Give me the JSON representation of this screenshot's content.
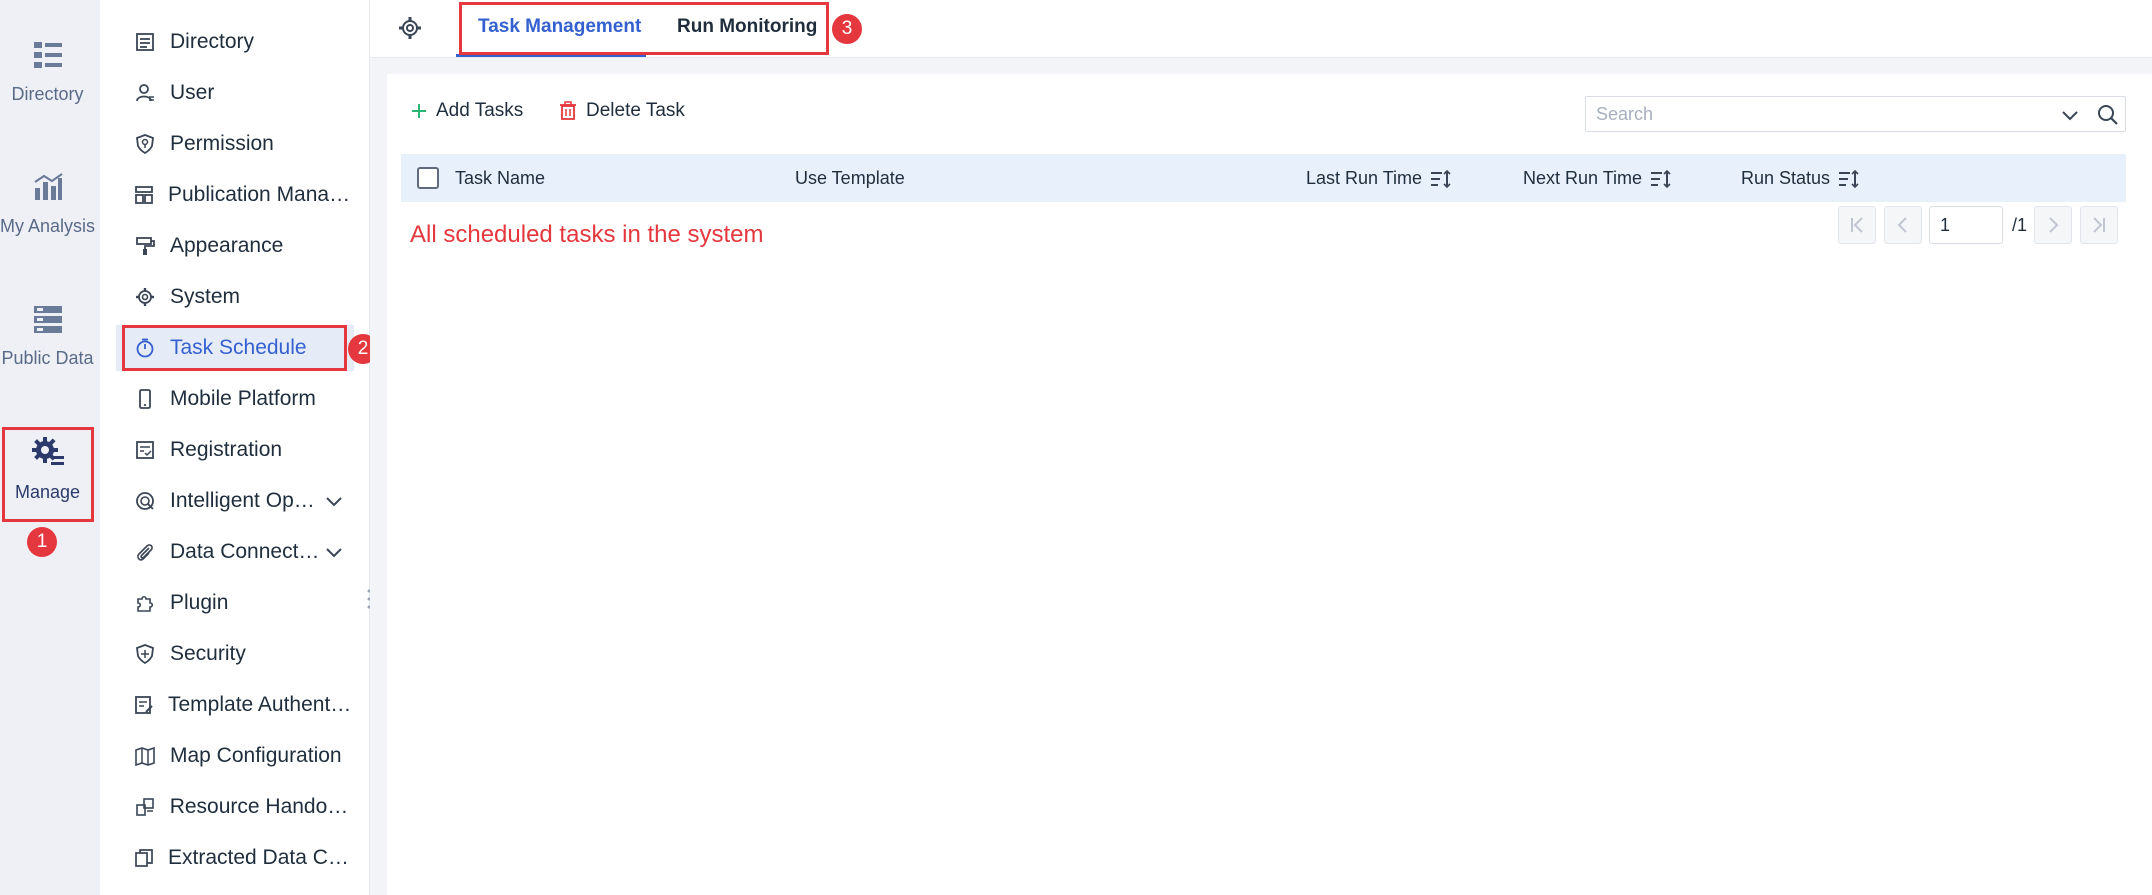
{
  "rail": {
    "items": [
      {
        "label": "Directory",
        "icon": "directory-list-icon"
      },
      {
        "label": "My Analysis",
        "icon": "analysis-chart-icon"
      },
      {
        "label": "Public Data",
        "icon": "public-data-icon"
      },
      {
        "label": "Manage",
        "icon": "manage-gear-icon"
      }
    ]
  },
  "menu": {
    "items": [
      {
        "label": "Directory",
        "icon": "directory-icon"
      },
      {
        "label": "User",
        "icon": "user-icon"
      },
      {
        "label": "Permission",
        "icon": "permission-shield-icon"
      },
      {
        "label": "Publication Management",
        "icon": "publication-icon"
      },
      {
        "label": "Appearance",
        "icon": "paint-roller-icon"
      },
      {
        "label": "System",
        "icon": "gear-icon"
      },
      {
        "label": "Task Schedule",
        "icon": "timer-icon"
      },
      {
        "label": "Mobile Platform",
        "icon": "mobile-icon"
      },
      {
        "label": "Registration",
        "icon": "registration-icon"
      },
      {
        "label": "Intelligent Operations",
        "icon": "intelligent-ops-icon"
      },
      {
        "label": "Data Connection",
        "icon": "paperclip-icon"
      },
      {
        "label": "Plugin",
        "icon": "puzzle-icon"
      },
      {
        "label": "Security",
        "icon": "shield-icon"
      },
      {
        "label": "Template Authentication",
        "icon": "template-auth-icon"
      },
      {
        "label": "Map Configuration",
        "icon": "map-icon"
      },
      {
        "label": "Resource Handover",
        "icon": "handover-icon"
      },
      {
        "label": "Extracted Data Cache",
        "icon": "copy-icon"
      }
    ]
  },
  "tabs": [
    {
      "label": "Task Management"
    },
    {
      "label": "Run Monitoring"
    }
  ],
  "toolbar": {
    "add_label": "Add Tasks",
    "delete_label": "Delete Task"
  },
  "search": {
    "placeholder": "Search"
  },
  "table": {
    "columns": [
      "Task Name",
      "Use Template",
      "Last Run Time",
      "Next Run Time",
      "Run Status"
    ],
    "rows": []
  },
  "annotation": "All scheduled tasks in the system",
  "callouts": [
    "1",
    "2",
    "3"
  ],
  "pagination": {
    "current_page": "1",
    "total_label": "/1"
  },
  "colors": {
    "accent": "#3560d0",
    "highlight": "#e5373e",
    "add_icon": "#2bb673",
    "delete_icon": "#e5373e"
  }
}
